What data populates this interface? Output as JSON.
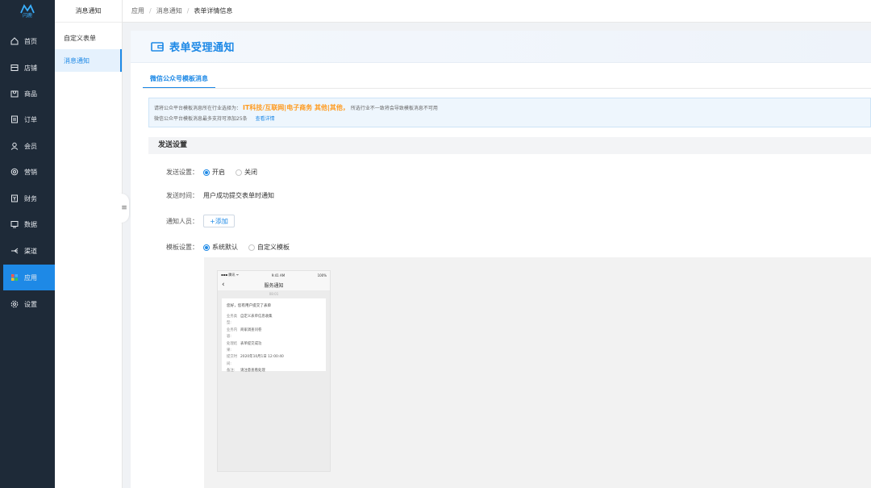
{
  "brand": {
    "logo_text": "闪鹿",
    "accent": "#1e89e6",
    "nav_bg": "#1e2a38"
  },
  "nav": {
    "items": [
      {
        "label": "首页",
        "icon": "home-icon"
      },
      {
        "label": "店铺",
        "icon": "store-icon"
      },
      {
        "label": "商品",
        "icon": "goods-icon"
      },
      {
        "label": "订单",
        "icon": "order-icon"
      },
      {
        "label": "会员",
        "icon": "member-icon"
      },
      {
        "label": "营销",
        "icon": "marketing-icon"
      },
      {
        "label": "财务",
        "icon": "finance-icon"
      },
      {
        "label": "数据",
        "icon": "data-icon"
      },
      {
        "label": "渠道",
        "icon": "channel-icon"
      },
      {
        "label": "应用",
        "icon": "apps-icon",
        "active": true
      },
      {
        "label": "设置",
        "icon": "settings-icon"
      }
    ]
  },
  "submenu": {
    "header": "消息通知",
    "items": [
      {
        "label": "自定义表单"
      },
      {
        "label": "消息通知",
        "active": true
      }
    ]
  },
  "breadcrumb": {
    "items": [
      "应用",
      "消息通知",
      "表单详情信息"
    ]
  },
  "page": {
    "title": "表单受理通知",
    "tab": "微信公众号模板消息",
    "notice": {
      "line1_prefix": "请将公众平台模板消息所在行业选择为：",
      "line1_highlight": "IT科技/互联网|电子商务 其他|其他，",
      "line1_suffix": "所选行业不一致将会导致模板消息不可用",
      "line2": "微信公众平台模板消息最多支持可添加25条",
      "link": "查看详情"
    },
    "section_title": "发送设置",
    "send_setting": {
      "label": "发送设置：",
      "options": [
        "开启",
        "关闭"
      ],
      "selected": 0
    },
    "send_time": {
      "label": "发送时间：",
      "value": "用户成功提交表单时通知"
    },
    "notify_people": {
      "label": "通知人员：",
      "button": "+添加"
    },
    "template_setting": {
      "label": "模板设置：",
      "options": [
        "系统默认",
        "自定义模板"
      ],
      "selected": 0
    }
  },
  "phone": {
    "carrier": "▪▪▪ 腾讯 ᯤ",
    "clock": "9:41 AM",
    "battery": "100%",
    "title": "服务通知",
    "time": "08:01",
    "greeting": "您好，您有用户提交了表单",
    "rows": [
      {
        "k": "业务类型:",
        "v": "自定义表单信息收集"
      },
      {
        "k": "业务内容:",
        "v": "商家调查问卷"
      },
      {
        "k": "处理结果:",
        "v": "表单提交成功"
      },
      {
        "k": "提交时间:",
        "v": "2020年10月1日 12:00:40"
      },
      {
        "k": "备注:",
        "v": "请注意查看处理"
      }
    ]
  }
}
